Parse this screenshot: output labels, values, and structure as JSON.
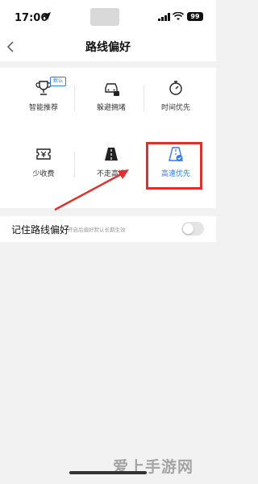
{
  "status_bar": {
    "time": "17:06",
    "battery": "99"
  },
  "nav": {
    "title": "路线偏好"
  },
  "options": [
    {
      "label": "智能推荐",
      "icon": "trophy-icon",
      "badge": "默认",
      "selected": false
    },
    {
      "label": "躲避拥堵",
      "icon": "car-avoid-icon",
      "selected": false
    },
    {
      "label": "时间优先",
      "icon": "stopwatch-icon",
      "selected": false
    },
    {
      "label": "少收费",
      "icon": "ticket-icon",
      "selected": false
    },
    {
      "label": "不走高速",
      "icon": "no-highway-icon",
      "selected": false
    },
    {
      "label": "高速优先",
      "icon": "highway-icon",
      "selected": true
    }
  ],
  "remember": {
    "label": "记住路线偏好",
    "hint": "开启后偏好默认长期生效",
    "enabled": false
  },
  "watermark": "爱上手游网",
  "colors": {
    "accent": "#2f7cf6",
    "annotation": "#e0302b"
  }
}
